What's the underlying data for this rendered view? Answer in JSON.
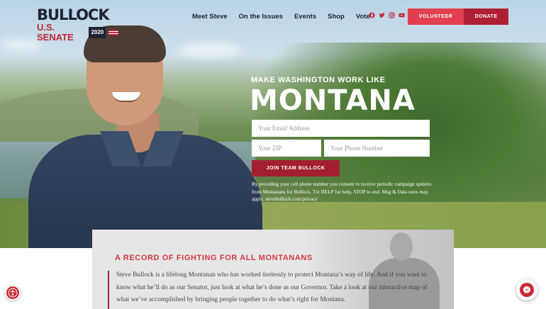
{
  "logo": {
    "name": "BULLOCK",
    "sub": "U.S. SENATE",
    "year": "2020"
  },
  "nav": {
    "items": [
      "Meet Steve",
      "On the Issues",
      "Events",
      "Shop",
      "Vote"
    ]
  },
  "social": {
    "icons": [
      "facebook-icon",
      "twitter-icon",
      "instagram-icon",
      "youtube-icon"
    ]
  },
  "buttons": {
    "volunteer": "VOLUNTEER",
    "donate": "DONATE",
    "join": "JOIN TEAM BULLOCK"
  },
  "hero": {
    "tagline": "MAKE WASHINGTON WORK LIKE",
    "title": "MONTANA",
    "email_placeholder": "Your Email Address",
    "zip_placeholder": "Your ZIP",
    "phone_placeholder": "Your Phone Number",
    "disclaimer": "By providing your cell phone number you consent to receive periodic campaign updates from Montanans for Bullock. Txt HELP for help, STOP to end. Msg & Data rates may apply. stevebullock.com/privacy"
  },
  "record": {
    "title": "A RECORD OF FIGHTING FOR ALL MONTANANS",
    "text": "Steve Bullock is a lifelong Montanan who has worked tirelessly to protect Montana’s way of life. And if you want to know what he’ll do as our Senator, just look at what he’s done as our Governor. Take a look at our interactive map of what we’ve accomplished by bringing people together to do what’s right for Montana."
  },
  "colors": {
    "brand_red": "#c1263a",
    "navy": "#1d2233",
    "volunteer": "#e2404f",
    "donate": "#b01f33"
  }
}
